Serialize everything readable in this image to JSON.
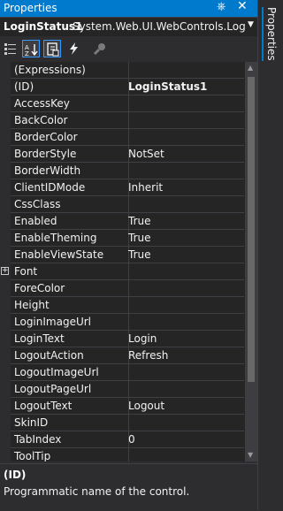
{
  "window": {
    "title": "Properties",
    "side_tab_label": "Properties",
    "pin_icon": "pin-icon",
    "close_icon": "close-icon"
  },
  "selector": {
    "object_name": "LoginStatus1",
    "object_type": "System.Web.UI.WebControls.LoginSta",
    "dropdown_icon": "chevron-down-icon"
  },
  "toolbar": {
    "buttons": [
      {
        "icon": "categorized-icon",
        "active": false
      },
      {
        "icon": "alphabetical-icon",
        "active": true
      },
      {
        "icon": "properties-icon",
        "active": true
      },
      {
        "icon": "events-icon",
        "active": false
      },
      {
        "icon": "property-pages-icon",
        "active": false
      }
    ]
  },
  "properties": [
    {
      "name": "(Expressions)",
      "value": ""
    },
    {
      "name": "(ID)",
      "value": "LoginStatus1",
      "bold": true
    },
    {
      "name": "AccessKey",
      "value": ""
    },
    {
      "name": "BackColor",
      "value": ""
    },
    {
      "name": "BorderColor",
      "value": ""
    },
    {
      "name": "BorderStyle",
      "value": "NotSet"
    },
    {
      "name": "BorderWidth",
      "value": ""
    },
    {
      "name": "ClientIDMode",
      "value": "Inherit"
    },
    {
      "name": "CssClass",
      "value": ""
    },
    {
      "name": "Enabled",
      "value": "True"
    },
    {
      "name": "EnableTheming",
      "value": "True"
    },
    {
      "name": "EnableViewState",
      "value": "True"
    },
    {
      "name": "Font",
      "value": "",
      "expandable": true
    },
    {
      "name": "ForeColor",
      "value": ""
    },
    {
      "name": "Height",
      "value": ""
    },
    {
      "name": "LoginImageUrl",
      "value": ""
    },
    {
      "name": "LoginText",
      "value": "Login"
    },
    {
      "name": "LogoutAction",
      "value": "Refresh"
    },
    {
      "name": "LogoutImageUrl",
      "value": ""
    },
    {
      "name": "LogoutPageUrl",
      "value": ""
    },
    {
      "name": "LogoutText",
      "value": "Logout"
    },
    {
      "name": "SkinID",
      "value": ""
    },
    {
      "name": "TabIndex",
      "value": "0"
    },
    {
      "name": "ToolTip",
      "value": ""
    }
  ],
  "description": {
    "title": "(ID)",
    "text": "Programmatic name of the control."
  },
  "colors": {
    "accent": "#007acc",
    "background": "#2d2d30",
    "grid": "#252526"
  }
}
